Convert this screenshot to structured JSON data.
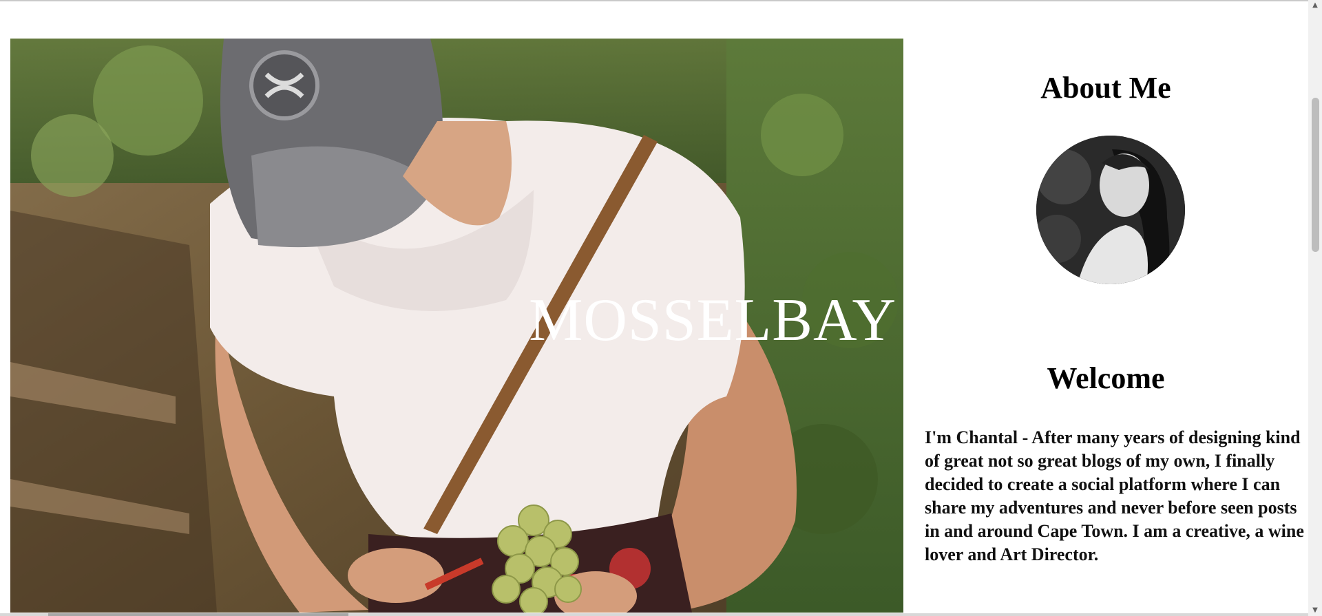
{
  "hero": {
    "title": "MOSSELBAY"
  },
  "sidebar": {
    "about_title": "About Me",
    "welcome_title": "Welcome",
    "intro_text": "I'm Chantal - After many years of designing kind of great not so great blogs of my own, I finally decided to create a social platform where I can share my adventures and never before seen posts in and around Cape Town. I am a creative, a wine lover and Art Director."
  },
  "icons": {
    "scroll_up": "triangle-up-icon",
    "scroll_down": "triangle-down-icon"
  },
  "colors": {
    "background": "#ffffff",
    "text": "#000000",
    "hero_title": "#ffffff"
  }
}
